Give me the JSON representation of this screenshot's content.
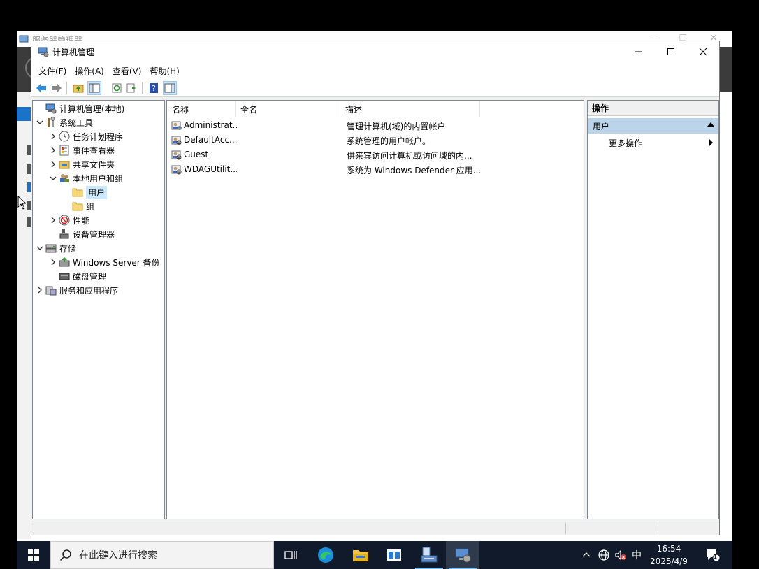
{
  "background_window": {
    "title": "服务器管理器"
  },
  "window": {
    "title": "计算机管理"
  },
  "menu": [
    "文件(F)",
    "操作(A)",
    "查看(V)",
    "帮助(H)"
  ],
  "tree": [
    {
      "label": "计算机管理(本地)",
      "level": 0,
      "expander": "",
      "icon": "computer-management-icon"
    },
    {
      "label": "系统工具",
      "level": 1,
      "expander": "down",
      "icon": "system-tools-icon"
    },
    {
      "label": "任务计划程序",
      "level": 2,
      "expander": "right",
      "icon": "task-scheduler-icon"
    },
    {
      "label": "事件查看器",
      "level": 2,
      "expander": "right",
      "icon": "event-viewer-icon"
    },
    {
      "label": "共享文件夹",
      "level": 2,
      "expander": "right",
      "icon": "shared-folders-icon"
    },
    {
      "label": "本地用户和组",
      "level": 2,
      "expander": "down",
      "icon": "local-users-groups-icon"
    },
    {
      "label": "用户",
      "level": 3,
      "expander": "",
      "icon": "folder-icon",
      "selected": true
    },
    {
      "label": "组",
      "level": 3,
      "expander": "",
      "icon": "folder-icon"
    },
    {
      "label": "性能",
      "level": 2,
      "expander": "right",
      "icon": "performance-icon"
    },
    {
      "label": "设备管理器",
      "level": 2,
      "expander": "",
      "icon": "device-manager-icon"
    },
    {
      "label": "存储",
      "level": 1,
      "expander": "down",
      "icon": "storage-icon"
    },
    {
      "label": "Windows Server 备份",
      "level": 2,
      "expander": "right",
      "icon": "server-backup-icon"
    },
    {
      "label": "磁盘管理",
      "level": 2,
      "expander": "",
      "icon": "disk-management-icon"
    },
    {
      "label": "服务和应用程序",
      "level": 1,
      "expander": "right",
      "icon": "services-apps-icon"
    }
  ],
  "list": {
    "columns": [
      "名称",
      "全名",
      "描述"
    ],
    "rows": [
      {
        "name": "Administrat...",
        "fullname": "",
        "description": "管理计算机(域)的内置帐户"
      },
      {
        "name": "DefaultAcc...",
        "fullname": "",
        "description": "系统管理的用户帐户。"
      },
      {
        "name": "Guest",
        "fullname": "",
        "description": "供来宾访问计算机或访问域的内..."
      },
      {
        "name": "WDAGUtilit...",
        "fullname": "",
        "description": "系统为 Windows Defender 应用..."
      }
    ]
  },
  "actions": {
    "header": "操作",
    "group": "用户",
    "items": [
      "更多操作"
    ]
  },
  "taskbar": {
    "search_placeholder": "在此键入进行搜索",
    "ime": "中",
    "time": "16:54",
    "date": "2025/4/9",
    "notification_count": "1"
  },
  "colors": {
    "selection": "#cce8ff",
    "action_group": "#bcd4ea",
    "taskbar": "#101a2a",
    "accent": "#1a73c8"
  }
}
